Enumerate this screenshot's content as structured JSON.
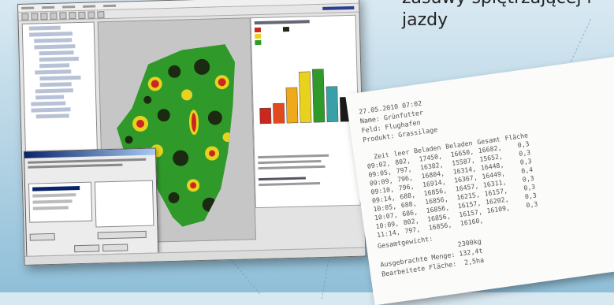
{
  "heading": {
    "line1": "zasuwy spiętrzającej r",
    "line2": "jazdy"
  },
  "receipt": {
    "datetime": "27.05.2010 07:02",
    "name": "Name: Grünfutter",
    "field": "Feld: Flughafen",
    "product": "Produkt: Grassilage",
    "columns": [
      "Zeit",
      "leer",
      "Beladen",
      "Beladen",
      "Gesamt",
      "Fläche"
    ],
    "rows": [
      [
        "09:02,",
        "802,",
        "17450,",
        "16650,",
        "16682,",
        "0,3"
      ],
      [
        "09:05,",
        "797,",
        "16382,",
        "15587,",
        "15652,",
        "0,3"
      ],
      [
        "09:09,",
        "796,",
        "16804,",
        "16314,",
        "16448,",
        "0,3"
      ],
      [
        "09:10,",
        "796,",
        "16914,",
        "16367,",
        "16449,",
        "0,4"
      ],
      [
        "09:14,",
        "688,",
        "16856,",
        "16457,",
        "16311,",
        "0,3"
      ],
      [
        "10:05,",
        "688,",
        "16856,",
        "16215,",
        "16157,",
        "0,3"
      ],
      [
        "10:07,",
        "686,",
        "16856,",
        "16157,",
        "16202,",
        "0,3"
      ],
      [
        "10:09,",
        "802,",
        "16856,",
        "16157,",
        "16109,",
        "0,3"
      ],
      [
        "11:14,",
        "797,",
        "16856,",
        "16160,",
        "",
        ""
      ]
    ],
    "total_weight_label": "Gesamtgewicht:",
    "total_weight_value": "2300kg",
    "harvested_label": "Ausgebrachte Menge:",
    "harvested_value": "132,4t",
    "area_label": "Bearbeitete Fläche:",
    "area_value": "2,5ha"
  },
  "colors": {
    "map_green": "#2f9a2a",
    "map_yellow": "#e8d21e",
    "map_red": "#c8281e",
    "map_dark": "#1c2a12",
    "receipt_text": "#555555",
    "background_top": "#d9e9f2",
    "background_bottom": "#8fbfd8"
  },
  "chart_bars": [
    {
      "color": "#c8281e",
      "value": 14
    },
    {
      "color": "#e04a1c",
      "value": 18
    },
    {
      "color": "#f0a91c",
      "value": 32
    },
    {
      "color": "#e8d21e",
      "value": 46
    },
    {
      "color": "#2f9a2a",
      "value": 48
    },
    {
      "color": "#3aa0a8",
      "value": 32
    },
    {
      "color": "#1a1a1a",
      "value": 22
    }
  ]
}
